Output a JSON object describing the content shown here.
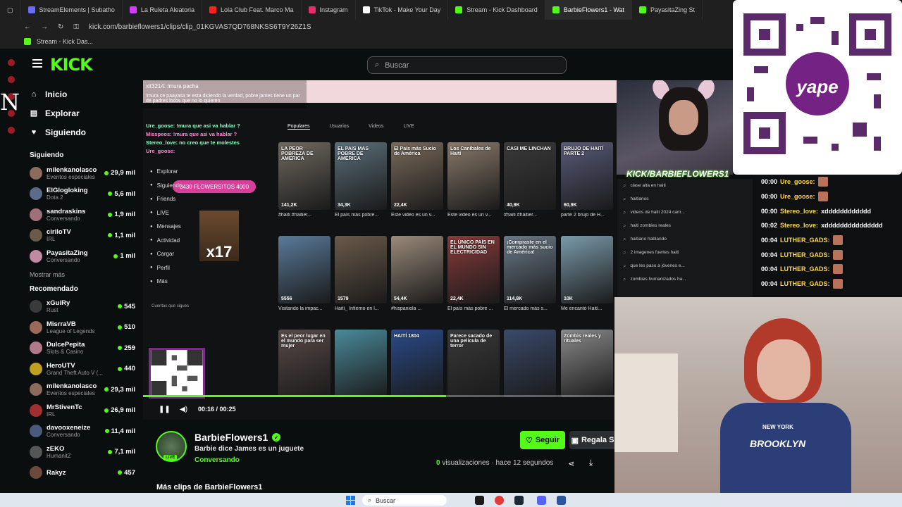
{
  "browser": {
    "tabs": [
      {
        "label": "StreamElements | Subatho",
        "color": "#6b6bff"
      },
      {
        "label": "La Ruleta Aleatoria",
        "color": "#d63aff"
      },
      {
        "label": "Lola Club Feat. Marco Ma",
        "color": "#ff2020"
      },
      {
        "label": "Instagram",
        "color": "#e1306c"
      },
      {
        "label": "TikTok - Make Your Day",
        "color": "#ffffff"
      },
      {
        "label": "Stream - Kick Dashboard",
        "color": "#53fc18"
      },
      {
        "label": "BarbieFlowers1 - Wat",
        "color": "#53fc18",
        "active": true
      },
      {
        "label": "PayasitaZing St",
        "color": "#53fc18"
      }
    ],
    "url": "kick.com/barbieflowers1/clips/clip_01KGVAS7QD768NKSS6T9Y26Z1S",
    "bookmark": "Stream - Kick Das..."
  },
  "kick": {
    "logo": "KICK",
    "search_placeholder": "Buscar",
    "accent": "#53fc18",
    "nav": [
      {
        "label": "Inicio",
        "icon": "home-icon",
        "glyph": "⌂"
      },
      {
        "label": "Explorar",
        "icon": "compass-icon",
        "glyph": "▤"
      },
      {
        "label": "Siguiendo",
        "icon": "heart-icon",
        "glyph": "♥"
      }
    ],
    "following_title": "Siguiendo",
    "following": [
      {
        "name": "milenkanolasco",
        "category": "Eventos especiales",
        "viewers": "29,9 mil",
        "color": "#8a6b5c"
      },
      {
        "name": "ElGlogloking",
        "category": "Dota 2",
        "viewers": "5,6 mil",
        "color": "#5c6b8a"
      },
      {
        "name": "sandraskins",
        "category": "Conversando",
        "viewers": "1,9 mil",
        "color": "#a0707a"
      },
      {
        "name": "ciriloTV",
        "category": "IRL",
        "viewers": "1,1 mil",
        "color": "#6a5a4a"
      },
      {
        "name": "PayasitaZing",
        "category": "Conversando",
        "viewers": "1 mil",
        "color": "#c08aa0"
      }
    ],
    "show_more": "Mostrar más",
    "recommended_title": "Recomendado",
    "recommended": [
      {
        "name": "xGuiRy",
        "category": "Rust",
        "viewers": "545",
        "color": "#3a3a3a"
      },
      {
        "name": "MisrraVB",
        "category": "League of Legends",
        "viewers": "510",
        "color": "#9a6a5a"
      },
      {
        "name": "DulcePepita",
        "category": "Slots & Casino",
        "viewers": "259",
        "color": "#b07a8a"
      },
      {
        "name": "HeroUTV",
        "category": "Grand Theft Auto V (...",
        "viewers": "440",
        "color": "#c0a020"
      },
      {
        "name": "milenkanolasco",
        "category": "Eventos especiales",
        "viewers": "29,3 mil",
        "color": "#8a6b5c"
      },
      {
        "name": "MrStivenTc",
        "category": "IRL",
        "viewers": "26,9 mil",
        "color": "#a03030"
      },
      {
        "name": "davooxeneize",
        "category": "Conversando",
        "viewers": "11,4 mil",
        "color": "#4a5a7a"
      },
      {
        "name": "zEKO",
        "category": "HumanitZ",
        "viewers": "7,1 mil",
        "color": "#555555"
      },
      {
        "name": "Rakyz",
        "category": "",
        "viewers": "457",
        "color": "#6a4a3a"
      }
    ]
  },
  "video": {
    "chat_line1": "xit3214: !mura pacha",
    "chat_line2": "!mura ce paayasa te esta diciendo la verdad, pobre james tiene un par de padres locos que no lo quieren",
    "overlay_chat": [
      "Ure_goose: !mura que asi va hablar ?",
      "Misspeos: !mura que asi va hablar ?",
      "Stereo_love: no creo que te molestes",
      "Ure_goose:"
    ],
    "flowers_badge": "3430 FLOWERSITOS 4000",
    "x17": "x17",
    "menu": [
      "Explorar",
      "Siguiendo",
      "Friends",
      "LIVE",
      "Mensajes",
      "Actividad",
      "Cargar",
      "Perfil",
      "Más"
    ],
    "following_accounts_title": "Cuentas que sigues",
    "tabs": [
      "Populares",
      "Usuarios",
      "Videos",
      "LIVE"
    ],
    "thumbs": [
      {
        "text": "LA PEOR POBREZA DE AMERICA",
        "cap": "#haiti #haitier...",
        "likes": "141,2K",
        "bg": "#6f6a60"
      },
      {
        "text": "EL PAIS MAS POBRE DE AMERICA",
        "cap": "El país más pobre...",
        "likes": "34,3K",
        "bg": "#5a6f7a"
      },
      {
        "text": "El País más Sucio de América",
        "cap": "Este video es un v...",
        "likes": "22,4K",
        "bg": "#7a6a5a"
      },
      {
        "text": "Los Caníbales de Haití",
        "cap": "Este video es un v...",
        "likes": "",
        "bg": "#8a7a6a"
      },
      {
        "text": "CASI ME LINCHAN",
        "cap": "#haiti #haitier...",
        "likes": "40,9K",
        "bg": "#3a3a3a"
      },
      {
        "text": "BRUJO DE HAITÍ PARTE 2",
        "cap": "parte 2 brujo de H...",
        "likes": "60,9K",
        "bg": "#5a5a7a"
      },
      {
        "text": "",
        "cap": "Visitando la impac...",
        "likes": "5556",
        "bg": "#5a7a9a"
      },
      {
        "text": "",
        "cap": "Haití_ Infierno en l...",
        "likes": "1579",
        "bg": "#6a5a4a"
      },
      {
        "text": "",
        "cap": "#hispaniola ...",
        "likes": "54,4K",
        "bg": "#9a8a7a"
      },
      {
        "text": "EL ÚNICO PAÍS EN EL MUNDO SIN ELECTRICIDAD",
        "cap": "El país más pobre ...",
        "likes": "22,4K",
        "bg": "#8a3a3a"
      },
      {
        "text": "¡Compraste en el mercado más sucio de América!",
        "cap": "El mercado más s...",
        "likes": "114,8K",
        "bg": "#6a7a8a"
      },
      {
        "text": "",
        "cap": "Me encantó Haití...",
        "likes": "10K",
        "bg": "#7a9aaa"
      },
      {
        "text": "Es el peor lugar en el mundo para ser mujer",
        "cap": "",
        "likes": "",
        "bg": "#5a4a4a"
      },
      {
        "text": "",
        "cap": "",
        "likes": "",
        "bg": "#4a8a9a"
      },
      {
        "text": "HAITÍ 1804",
        "cap": "",
        "likes": "",
        "bg": "#2a4a8a"
      },
      {
        "text": "Parece sacado de una película de terror",
        "cap": "",
        "likes": "",
        "bg": "#3a3a3a"
      },
      {
        "text": "",
        "cap": "",
        "likes": "",
        "bg": "#3a4a6a"
      },
      {
        "text": "Zombis reales y rituales",
        "cap": "",
        "likes": "",
        "bg": "#8a8a8a"
      }
    ],
    "time": "00:16 / 00:25",
    "progress": 0.64
  },
  "channel": {
    "name": "BarbieFlowers1",
    "live": "LIVE",
    "clip_title": "Barbie dice James es un juguete",
    "category": "Conversando",
    "follow_label": "Seguir",
    "gift_label": "Regala S",
    "views_count": "0",
    "views_suffix": "visualizaciones",
    "time_ago": "hace 12 segundos",
    "more_clips": "Más clips de BarbieFlowers1"
  },
  "overlay": {
    "name": "KICK/BARBIEFLOWERS1",
    "search_suggestions": [
      "clase alta en haiti",
      "haitianos",
      "videos de haiti 2024 cam...",
      "haiti zombies reales",
      "haitiano hablando",
      "2 imagenes fuertes haiti",
      "que les paso a jóvenes e...",
      "zombies humanizados ha..."
    ],
    "chat": [
      {
        "time": "00:00",
        "user": "Ure_goose:",
        "text": "",
        "emote": true
      },
      {
        "time": "00:00",
        "user": "Ure_goose:",
        "text": "",
        "emote": true
      },
      {
        "time": "00:00",
        "user": "Stereo_love:",
        "text": "xdddddddddddd",
        "emote": false
      },
      {
        "time": "00:02",
        "user": "Stereo_love:",
        "text": "xddddddddddddddd",
        "emote": false
      },
      {
        "time": "00:04",
        "user": "LUTHER_GADS:",
        "text": "",
        "emote": true
      },
      {
        "time": "00:04",
        "user": "LUTHER_GADS:",
        "text": "",
        "emote": true
      },
      {
        "time": "00:04",
        "user": "LUTHER_GADS:",
        "text": "",
        "emote": true
      },
      {
        "time": "00:04",
        "user": "LUTHER_GADS:",
        "text": "",
        "emote": true
      }
    ],
    "shirt_brand": "NEW YORK",
    "shirt_text": "BROOKLYN",
    "left_letter": "N"
  },
  "taskbar": {
    "search": "Buscar"
  }
}
